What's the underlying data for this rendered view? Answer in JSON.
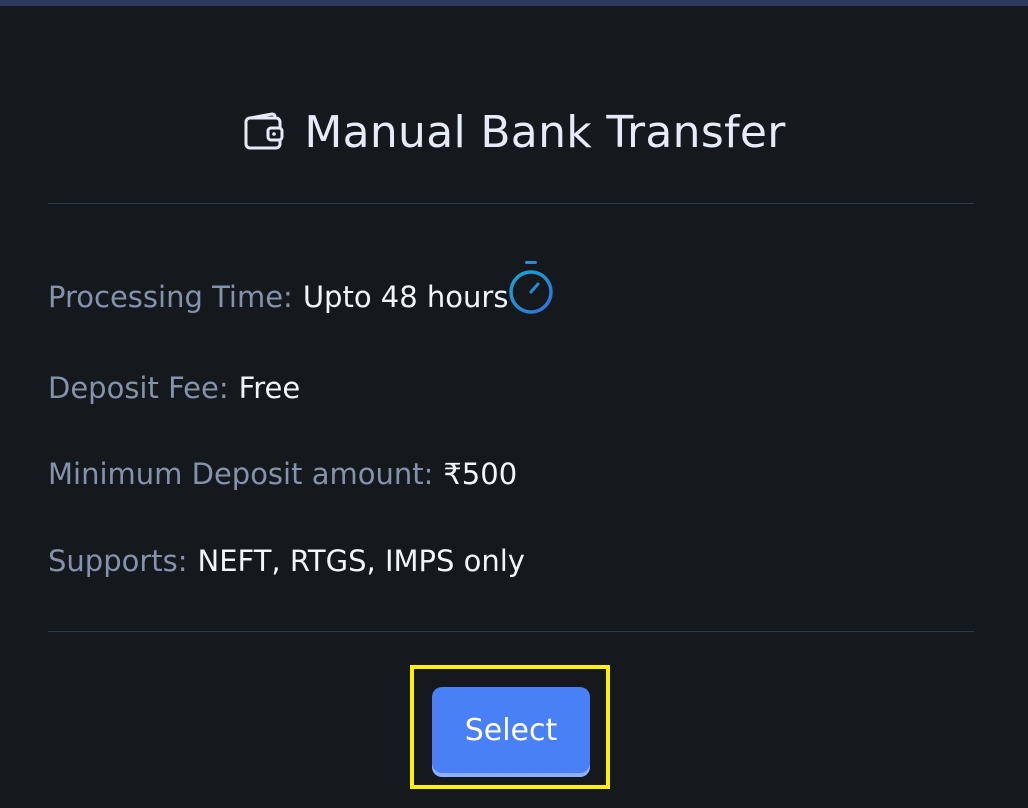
{
  "title": "Manual Bank Transfer",
  "icons": {
    "title_icon": "wallet-icon",
    "processing_icon": "timer-icon"
  },
  "details": {
    "processing_time": {
      "label": "Processing Time:",
      "value": "Upto 48 hours"
    },
    "deposit_fee": {
      "label": "Deposit Fee:",
      "value": "Free"
    },
    "minimum_deposit": {
      "label": "Minimum Deposit amount:",
      "value": "₹500"
    },
    "supports": {
      "label": "Supports:",
      "value": "NEFT, RTGS, IMPS only"
    }
  },
  "actions": {
    "select_label": "Select"
  },
  "colors": {
    "background": "#15181c",
    "label": "#8592ab",
    "value": "#f2f5fb",
    "accent": "#4a80f5",
    "highlight": "#fff200"
  }
}
